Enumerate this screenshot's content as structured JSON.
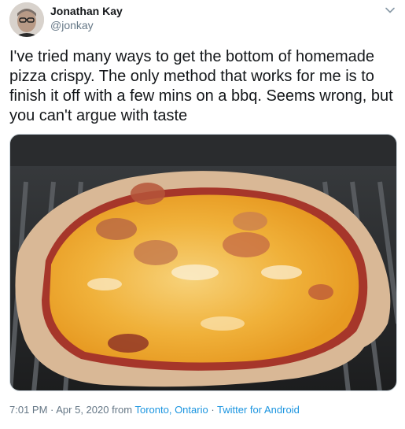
{
  "author": {
    "name": "Jonathan Kay",
    "handle": "@jonkay"
  },
  "tweet": {
    "text": "I've tried many ways to get the bottom of homemade pizza crispy. The only method that works for me is to finish it off with a few mins on a bbq. Seems wrong, but you can't argue with taste"
  },
  "media": {
    "subject": "homemade cheese pizza on a bbq grill"
  },
  "meta": {
    "time": "7:01 PM",
    "sep1": " · ",
    "date": "Apr 5, 2020",
    "from_word": " from ",
    "location": "Toronto, Ontario",
    "sep2": " · ",
    "source": "Twitter for Android"
  },
  "icons": {
    "menu": "chevron-down-icon"
  },
  "colors": {
    "text": "#14171a",
    "secondary": "#657786",
    "link": "#1b95e0"
  }
}
